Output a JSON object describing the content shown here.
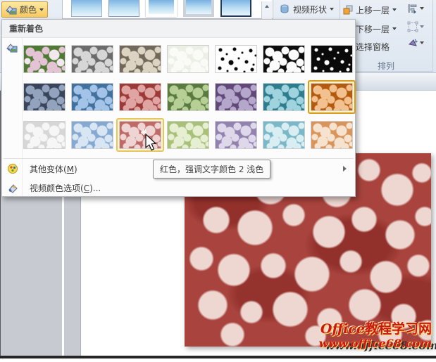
{
  "colors": {
    "selection-gold": "#d79b1e",
    "hover-gold": "#e6c65f",
    "button-active-bg1": "#fde9a2",
    "button-active-bg2": "#f7c95f",
    "button-active-border": "#c79a3e",
    "watermark-red": "#cc1515",
    "slide-image-bg": "#a8433d",
    "slide-image-fg": "#eed6d1"
  },
  "ribbon": {
    "color_button": {
      "label": "颜色"
    },
    "style_gallery": {
      "items": [
        {
          "frame": "plain"
        },
        {
          "frame": "simple"
        },
        {
          "frame": "white"
        },
        {
          "frame": "gray"
        },
        {
          "frame": "selected"
        }
      ]
    },
    "video_shape_button": {
      "label": "视频形状"
    },
    "arrange_group": {
      "bring_forward": "上移一层",
      "send_backward": "下移一层",
      "selection_pane": "选择窗格",
      "group_label": "排列"
    }
  },
  "menu": {
    "header": "重新着色",
    "tooltip": "红色，强调文字颜色 2 浅色",
    "gallery": {
      "rows": [
        {
          "tiles": [
            {
              "bg": "#4f7a33",
              "fg": "#e3c3d4",
              "fg2": "#f2e8ee",
              "pattern": "blobs"
            },
            {
              "bg": "#6b6b6b",
              "fg": "#d6d6d6",
              "pattern": "blobs"
            },
            {
              "bg": "#71675a",
              "fg": "#ddd3c2",
              "pattern": "blobs"
            },
            {
              "bg": "#ecefe6",
              "fg": "#fafbf6",
              "pattern": "blobs"
            },
            {
              "bg": "#ffffff",
              "fg": "#0a0a0a",
              "pattern": "dots"
            },
            {
              "bg": "#0c0c0c",
              "fg": "#fcfcfc",
              "pattern": "blobs"
            },
            {
              "bg": "#0a0a0a",
              "fg": "#ffffff",
              "pattern": "dots"
            }
          ]
        },
        {
          "tiles": [
            {
              "bg": "#39455a",
              "fg": "#93a3bd",
              "pattern": "blobs"
            },
            {
              "bg": "#41719c",
              "fg": "#a3c4e8",
              "pattern": "blobs"
            },
            {
              "bg": "#9c3a38",
              "fg": "#e0a5a3",
              "pattern": "blobs"
            },
            {
              "bg": "#5a7a40",
              "fg": "#b5cf95",
              "pattern": "blobs"
            },
            {
              "bg": "#604878",
              "fg": "#b5a6cb",
              "pattern": "blobs"
            },
            {
              "bg": "#2e7d8f",
              "fg": "#9fd4de",
              "pattern": "blobs"
            },
            {
              "bg": "#b35a0e",
              "fg": "#f3c08f",
              "pattern": "blobs",
              "selected": true
            }
          ]
        },
        {
          "tiles": [
            {
              "bg": "#d6d6d6",
              "fg": "#f6f6f6",
              "pattern": "blobs"
            },
            {
              "bg": "#86a9d1",
              "fg": "#d8e6f4",
              "pattern": "blobs"
            },
            {
              "bg": "#bf6a66",
              "fg": "#eed5d3",
              "pattern": "blobs",
              "hovered": true
            },
            {
              "bg": "#a8c078",
              "fg": "#e6efd2",
              "pattern": "blobs"
            },
            {
              "bg": "#9183ae",
              "fg": "#ded8ea",
              "pattern": "blobs"
            },
            {
              "bg": "#7ab8c8",
              "fg": "#d9eef3",
              "pattern": "blobs"
            },
            {
              "bg": "#d9945c",
              "fg": "#f6e3cf",
              "pattern": "blobs"
            }
          ]
        }
      ]
    },
    "items": [
      {
        "pre": "其他变体(",
        "key": "M",
        "post": ")"
      },
      {
        "pre": "视频颜色选项(",
        "key": "C",
        "post": ")..."
      }
    ]
  },
  "watermark": {
    "line1_en": "Office",
    "line1_cn": "教程学习网",
    "line2": "www.office68.com"
  }
}
